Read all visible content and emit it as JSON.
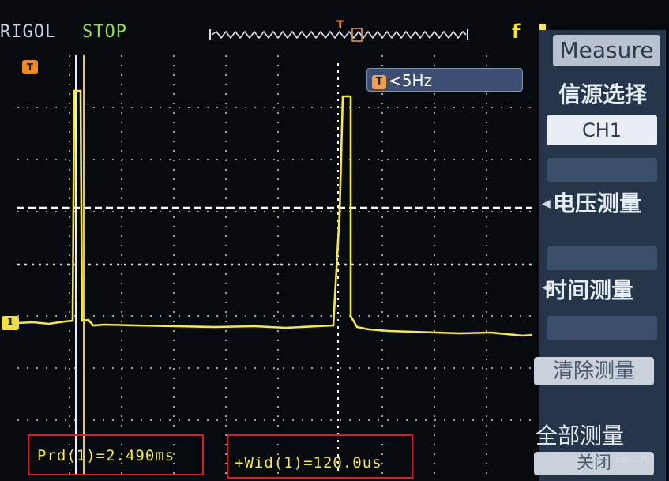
{
  "header": {
    "brand": "RIGOL",
    "run_status": "STOP",
    "trigger_mark": "T",
    "trigger_symbol": "f"
  },
  "plot": {
    "trigger_freq": "<5Hz",
    "trigger_freq_icon": "T",
    "channel_marker": "1",
    "time_marker": "T"
  },
  "measurements": {
    "period": "Prd(1)=2.490ms",
    "width": "+Wid(1)=120.0us"
  },
  "menu": {
    "title": "Measure",
    "source_label": "信源选择",
    "source_value": "CH1",
    "voltage_label": "电压测量",
    "time_label": "时间测量",
    "clear_label": "清除测量",
    "all_label": "全部测量",
    "all_value": "关闭"
  },
  "watermark": "Leo_LYF",
  "colors": {
    "trace": "#f4e93c",
    "grid": "#ffffff",
    "menu_bg": "#26354a",
    "highlight_box": "#e21b1b"
  }
}
